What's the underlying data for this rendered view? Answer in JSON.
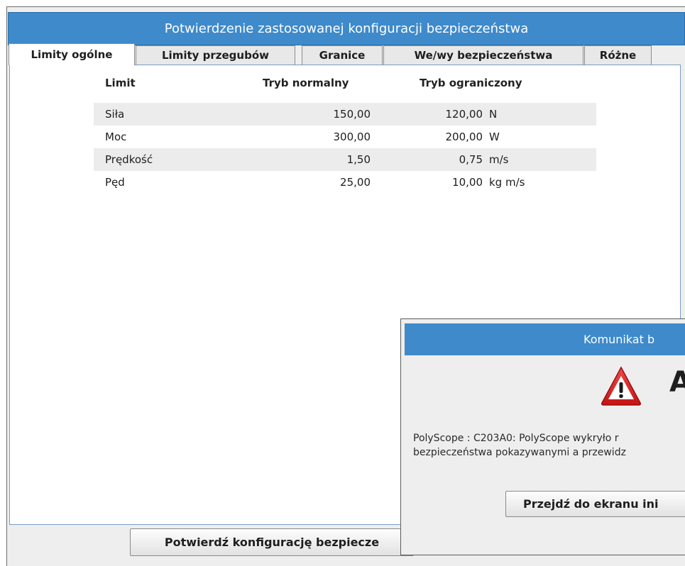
{
  "window": {
    "title": "Potwierdzenie zastosowanej konfiguracji bezpieczeństwa"
  },
  "tabs": [
    {
      "label": "Limity ogólne",
      "active": true
    },
    {
      "label": "Limity przegubów",
      "active": false
    },
    {
      "label": "Granice",
      "active": false
    },
    {
      "label": "We/wy bezpieczeństwa",
      "active": false
    },
    {
      "label": "Różne",
      "active": false
    }
  ],
  "limits_table": {
    "headers": [
      "Limit",
      "Tryb normalny",
      "Tryb ograniczony"
    ],
    "rows": [
      {
        "name": "Siła",
        "normal": "150,00",
        "reduced": "120,00",
        "unit": "N"
      },
      {
        "name": "Moc",
        "normal": "300,00",
        "reduced": "200,00",
        "unit": "W"
      },
      {
        "name": "Prędkość",
        "normal": "1,50",
        "reduced": "0,75",
        "unit": "m/s"
      },
      {
        "name": "Pęd",
        "normal": "25,00",
        "reduced": "10,00",
        "unit": "kg m/s"
      }
    ]
  },
  "confirm_button": {
    "label": "Potwierdź konfigurację bezpiecze"
  },
  "dialog": {
    "title": "Komunikat b",
    "heading": "A",
    "icon": "warning-triangle-icon",
    "message_line1": "PolyScope : C203A0: PolyScope wykryło r",
    "message_line2": "bezpieczeństwa pokazywanymi a przewidz",
    "button_label": "Przejdź do ekranu ini"
  },
  "colors": {
    "title_bar": "#3e8acb",
    "warning_red": "#d92020"
  }
}
